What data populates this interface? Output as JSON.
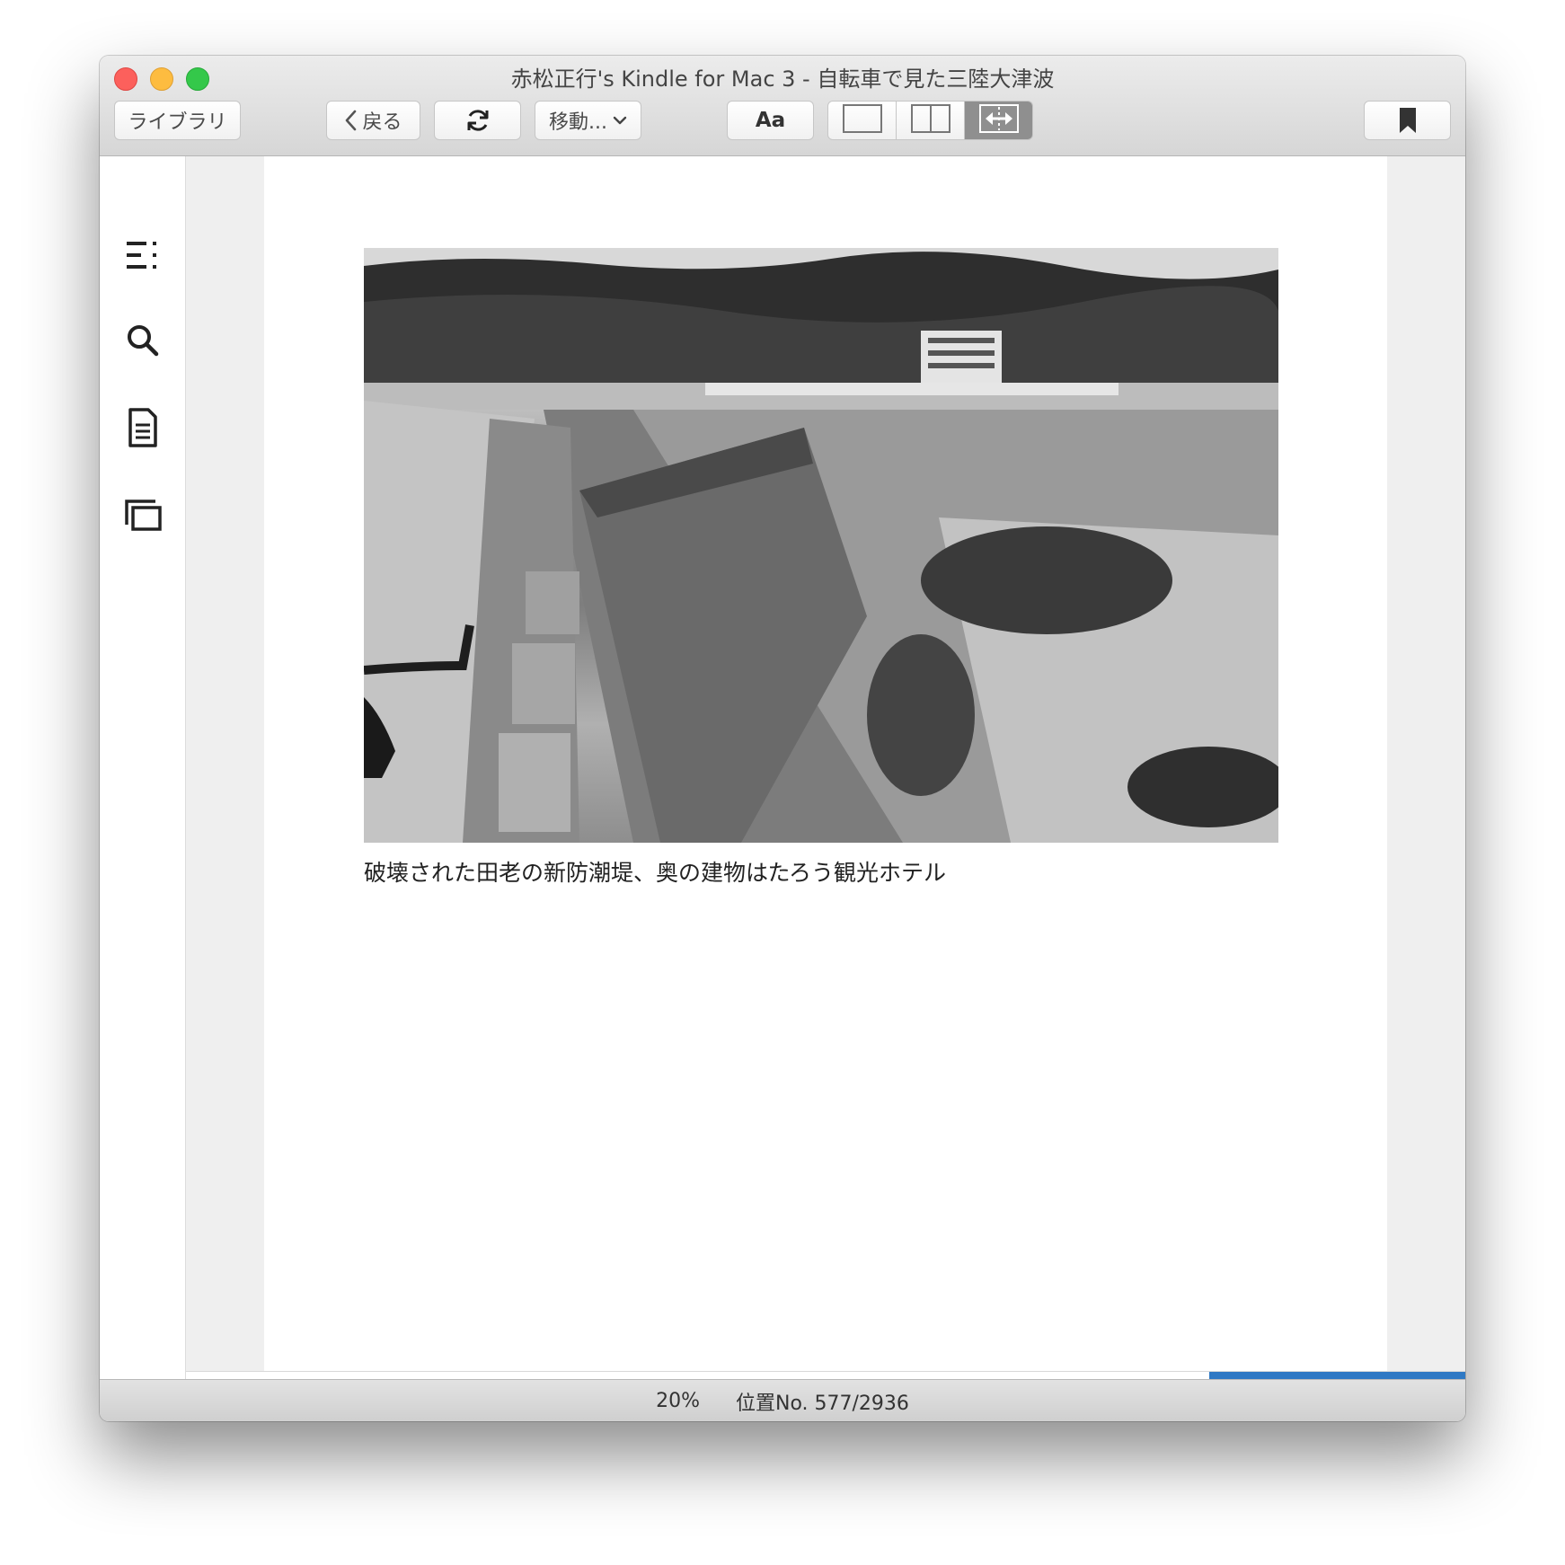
{
  "window": {
    "title": "赤松正行's Kindle for Mac 3 - 自転車で見た三陸大津波"
  },
  "toolbar": {
    "library_label": "ライブラリ",
    "back_label": "戻る",
    "goto_label": "移動...",
    "font_label": "Aa",
    "view_modes": [
      "single-page-icon",
      "two-page-icon",
      "fit-width-icon"
    ],
    "active_view_mode": "fit-width-icon"
  },
  "sidebar": {
    "items": [
      "table-of-contents-icon",
      "search-icon",
      "notes-icon",
      "flashcards-icon"
    ]
  },
  "page": {
    "image_caption": "破壊された田老の新防潮堤、奥の建物はたろう観光ホテル"
  },
  "status": {
    "percent": "20%",
    "location": "位置No. 577/2936",
    "progress_fraction": 0.2
  },
  "colors": {
    "progress": "#2f79c4",
    "close": "#fc605c",
    "minimize": "#fdbc40",
    "maximize": "#34c84a"
  }
}
